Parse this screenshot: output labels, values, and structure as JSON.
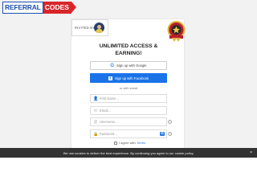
{
  "logo": {
    "left": "REFERRAL",
    "right": "CODES"
  },
  "invited": {
    "label": "INVITED BY"
  },
  "title": "UNLIMITED ACCESS & EARNING!",
  "google_button": {
    "label": "Sign up with Google",
    "icon": "google-g-icon"
  },
  "facebook_button": {
    "label": "Sign up with Facebook",
    "icon": "facebook-icon"
  },
  "divider": "or with email",
  "fields": {
    "first_name": {
      "placeholder": "First Name..."
    },
    "email": {
      "placeholder": "Email..."
    },
    "username": {
      "placeholder": "Username..."
    },
    "password": {
      "placeholder": "Password..."
    }
  },
  "agree": {
    "prefix": "I agree with",
    "link": "Terms"
  },
  "cookie_banner": {
    "text": "We use cookies to deliver the best experience. By continuing you agree to our cookie policy.",
    "close": "×"
  },
  "colors": {
    "brand_blue": "#1f4fb0",
    "brand_red": "#d8262a",
    "facebook_blue": "#1a73e8",
    "cookie_bg": "#333333"
  }
}
